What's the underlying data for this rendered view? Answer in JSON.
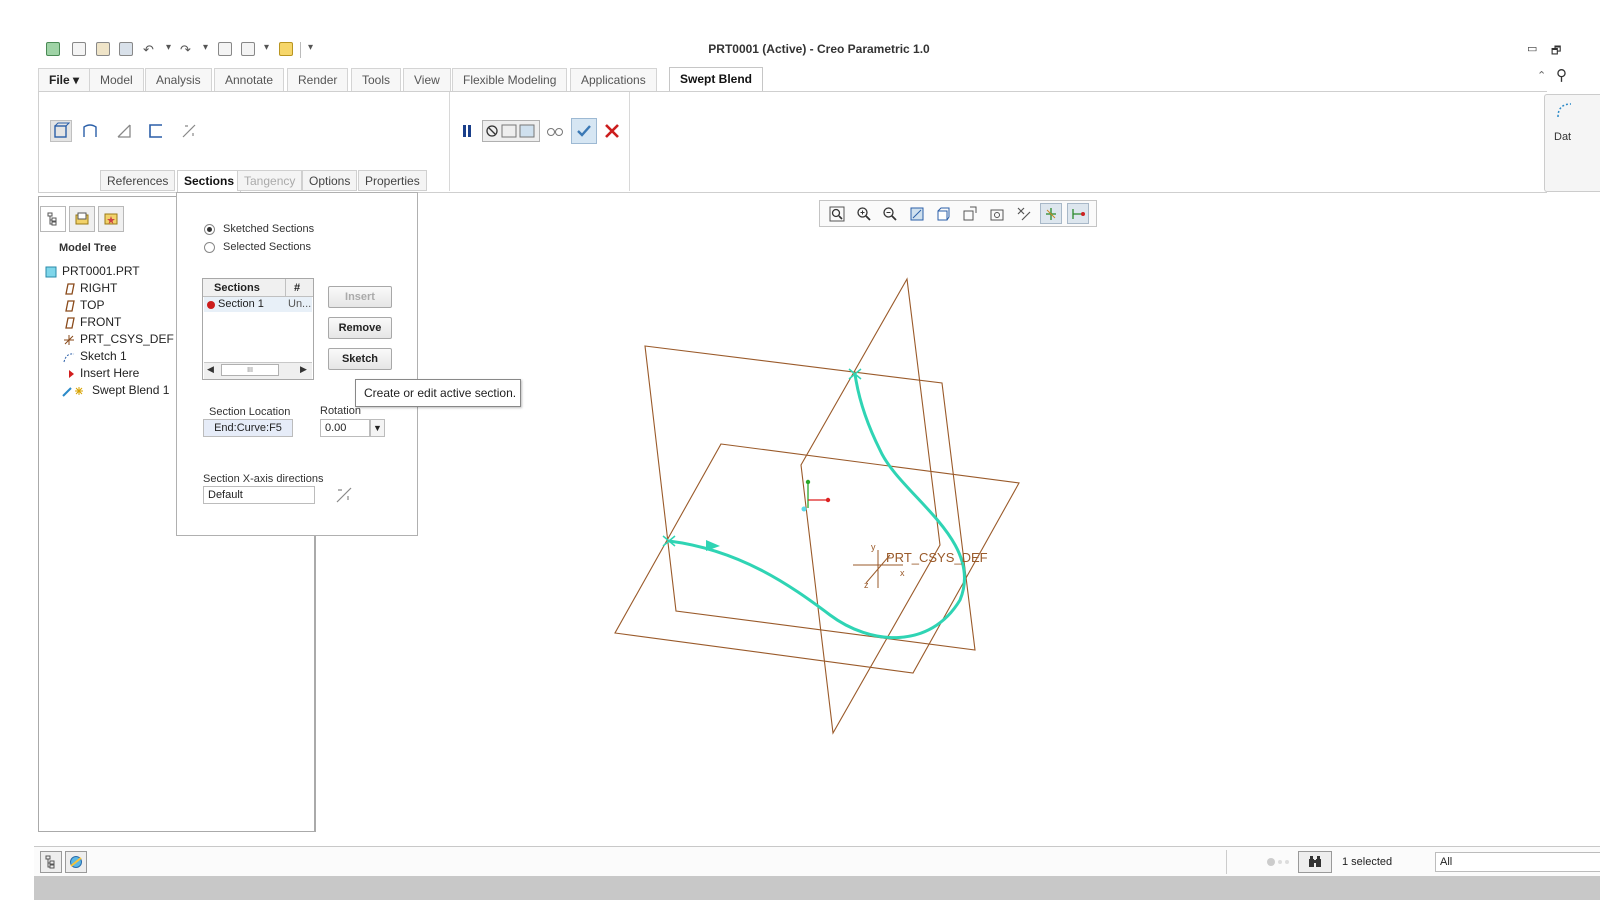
{
  "window": {
    "title": "PRT0001 (Active) - Creo Parametric 1.0",
    "minimize_glyph": "▭",
    "restore_glyph": "🗗"
  },
  "ribbon_tabs": [
    {
      "label": "File ▾"
    },
    {
      "label": "Model"
    },
    {
      "label": "Analysis"
    },
    {
      "label": "Annotate"
    },
    {
      "label": "Render"
    },
    {
      "label": "Tools"
    },
    {
      "label": "View"
    },
    {
      "label": "Flexible Modeling"
    },
    {
      "label": "Applications"
    },
    {
      "label": "Swept Blend"
    }
  ],
  "dashboard_tabs": [
    {
      "label": "References",
      "state": "normal"
    },
    {
      "label": "Sections",
      "state": "active"
    },
    {
      "label": "Tangency",
      "state": "disabled"
    },
    {
      "label": "Options",
      "state": "normal"
    },
    {
      "label": "Properties",
      "state": "normal"
    }
  ],
  "right_stub": {
    "label": "Dat"
  },
  "model_tree": {
    "header": "Model Tree",
    "items": [
      {
        "label": "PRT0001.PRT",
        "icon": "part-icon"
      },
      {
        "label": "RIGHT",
        "icon": "datum-plane-icon"
      },
      {
        "label": "TOP",
        "icon": "datum-plane-icon"
      },
      {
        "label": "FRONT",
        "icon": "datum-plane-icon"
      },
      {
        "label": "PRT_CSYS_DEF",
        "icon": "csys-icon"
      },
      {
        "label": "Sketch 1",
        "icon": "sketch-icon"
      },
      {
        "label": "Insert Here",
        "icon": "insert-arrow-icon"
      },
      {
        "label": "Swept Blend 1",
        "icon": "swept-blend-icon"
      }
    ]
  },
  "sections_panel": {
    "radio_sketched": "Sketched Sections",
    "radio_selected": "Selected Sections",
    "table_header_sections": "Sections",
    "table_header_num": "#",
    "row_label": "Section 1",
    "row_num": "Un...",
    "scroll_thumb": "III",
    "insert_label": "Insert",
    "remove_label": "Remove",
    "sketch_label": "Sketch",
    "section_location_label": "Section Location",
    "section_location_value": "End:Curve:F5",
    "rotation_label": "Rotation",
    "rotation_value": "0.00",
    "xaxis_label": "Section X-axis directions",
    "xaxis_value": "Default"
  },
  "tooltip": "Create or edit active section.",
  "viewport": {
    "csys_label": "PRT_CSYS_DEF",
    "axis_x": "x",
    "axis_y": "y",
    "axis_z": "z",
    "plane_color": "#9a5a2a",
    "curve_color": "#2fd4b4"
  },
  "status_bar": {
    "selected": "1 selected",
    "filter": "All"
  }
}
